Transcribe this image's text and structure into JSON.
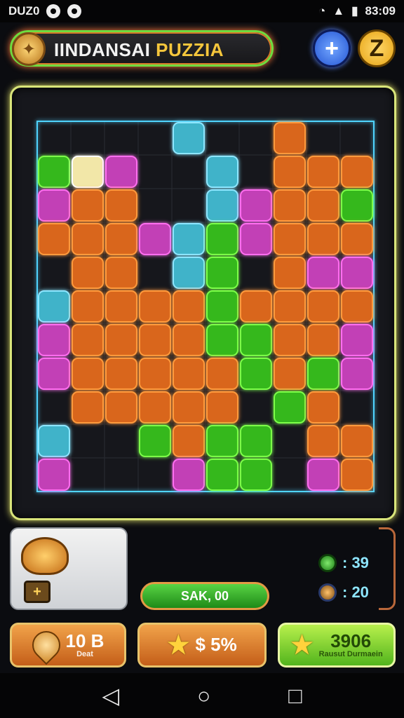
{
  "status": {
    "left_text": "DUZ0",
    "time": "83:09"
  },
  "header": {
    "title_part1": "IINDANSAI",
    "title_part2": "PUZZIA",
    "plus_label": "+",
    "help_label": "Z"
  },
  "board": {
    "note": ""
  },
  "lower": {
    "score_button_label": "SAK, 00",
    "chest_symbol": "+",
    "stat_green": ": 39",
    "stat_orange": ": 20"
  },
  "bottom_buttons": {
    "btn1_value": "10 B",
    "btn1_caption": "Deat",
    "btn2_value": "$ 5%",
    "btn3_value": "3906",
    "btn3_caption": "Rausut Durmaein"
  },
  "nav": {
    "back": "◁",
    "home": "○",
    "recent": "□"
  },
  "colors": {
    "accent_green": "#6fdc3f",
    "accent_orange": "#ff7a3b",
    "cyan": "#8ee6ff"
  }
}
